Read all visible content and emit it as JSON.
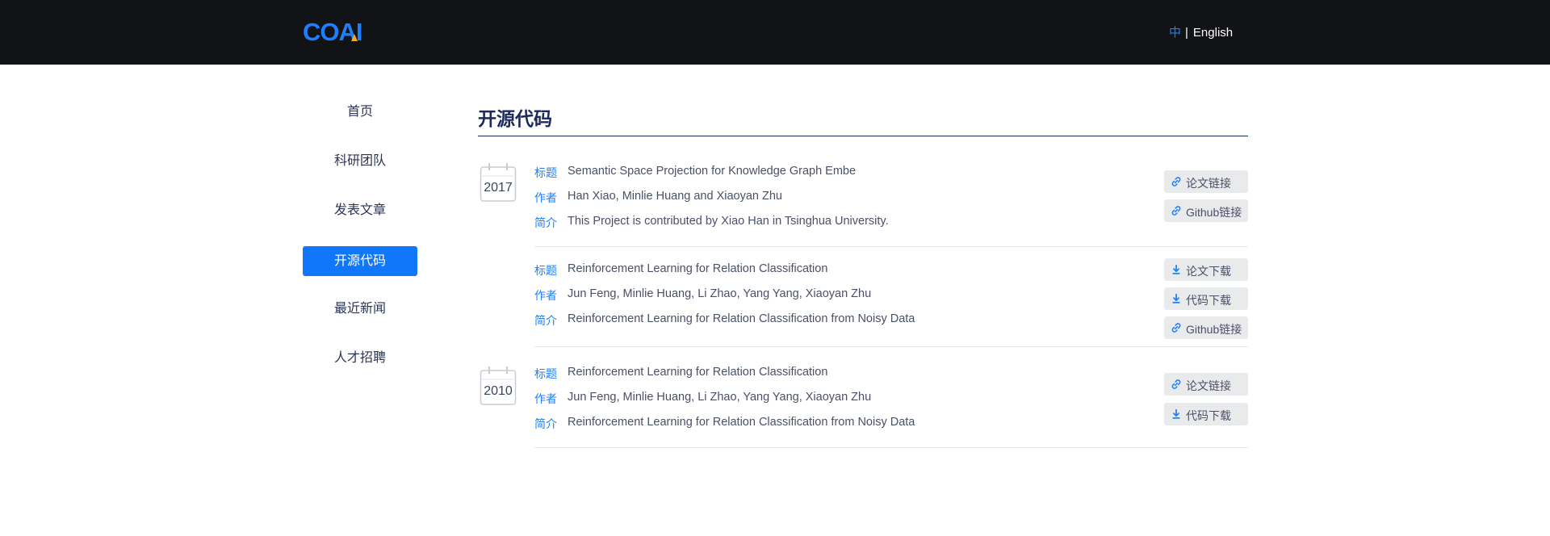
{
  "header": {
    "logo_text": "COAI",
    "lang_zh": "中",
    "lang_sep": "|",
    "lang_en": "English"
  },
  "sidebar": {
    "items": [
      {
        "label": "首页"
      },
      {
        "label": "科研团队"
      },
      {
        "label": "发表文章"
      },
      {
        "label": "开源代码",
        "active": true
      },
      {
        "label": "最近新闻"
      },
      {
        "label": "人才招聘"
      }
    ]
  },
  "main": {
    "title": "开源代码",
    "field_labels": {
      "title": "标题",
      "author": "作者",
      "intro": "简介"
    },
    "years": [
      "2017",
      "2010"
    ],
    "entries": [
      {
        "title": "Semantic Space Projection for Knowledge Graph Embe",
        "author": "Han Xiao, Minlie Huang and Xiaoyan Zhu",
        "intro": "This Project is contributed by Xiao Han in Tsinghua University.",
        "buttons": [
          {
            "label": "论文链接",
            "icon": "link-icon"
          },
          {
            "label": "Github链接",
            "icon": "link-icon"
          }
        ]
      },
      {
        "title": "Reinforcement Learning for Relation Classification",
        "author": "Jun Feng, Minlie Huang, Li Zhao, Yang Yang, Xiaoyan Zhu",
        "intro": "Reinforcement Learning for Relation Classification from Noisy Data",
        "buttons": [
          {
            "label": "论文下载",
            "icon": "download-icon"
          },
          {
            "label": "代码下载",
            "icon": "download-icon"
          },
          {
            "label": "Github链接",
            "icon": "link-icon"
          }
        ]
      },
      {
        "title": "Reinforcement Learning for Relation Classification",
        "author": "Jun Feng, Minlie Huang, Li Zhao, Yang Yang, Xiaoyan Zhu",
        "intro": "Reinforcement Learning for Relation Classification from Noisy Data",
        "buttons": [
          {
            "label": "论文链接",
            "icon": "link-icon"
          },
          {
            "label": "代码下载",
            "icon": "download-icon"
          }
        ]
      }
    ]
  },
  "colors": {
    "header_bg": "#121316",
    "accent": "#1177fa",
    "nav_text": "#2a3554",
    "title_text": "#1c2a5c",
    "body_text": "#4a5068",
    "button_bg": "#e9eaec"
  }
}
